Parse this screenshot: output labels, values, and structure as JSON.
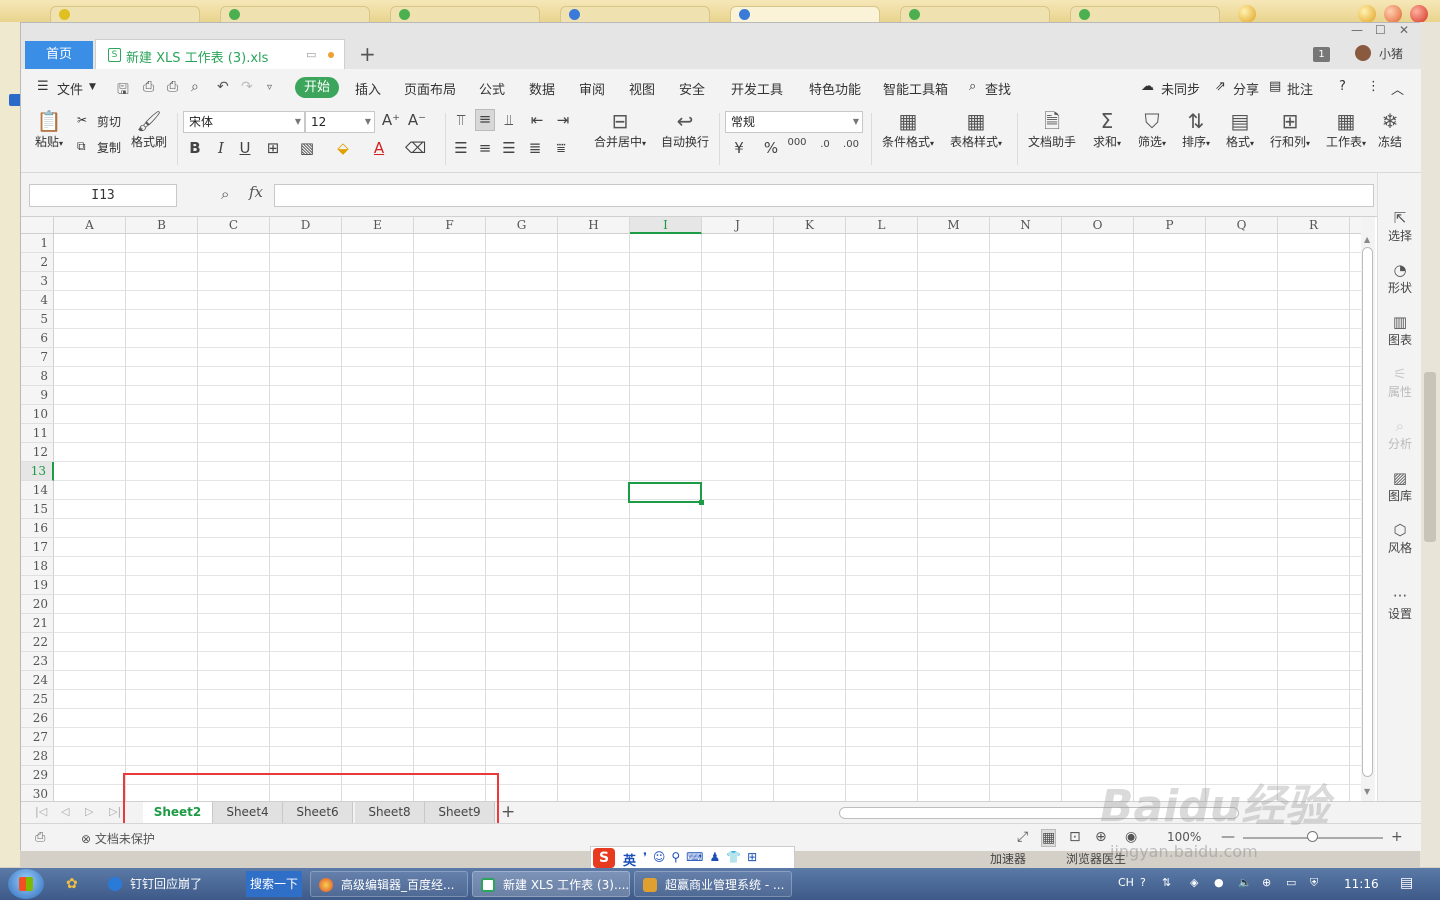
{
  "app": {
    "home_tab": "首页",
    "doc_tab": "新建 XLS 工作表 (3).xls",
    "tab_count": "1",
    "username": "小猪"
  },
  "menu": {
    "file": "文件",
    "items": [
      "开始",
      "插入",
      "页面布局",
      "公式",
      "数据",
      "审阅",
      "视图",
      "安全",
      "开发工具",
      "特色功能",
      "智能工具箱"
    ],
    "search": "查找",
    "right": [
      "未同步",
      "分享",
      "批注"
    ]
  },
  "ribbon": {
    "paste": "粘贴",
    "cut": "剪切",
    "copy": "复制",
    "format_painter": "格式刷",
    "font_name": "宋体",
    "font_size": "12",
    "merge_center": "合并居中",
    "auto_wrap": "自动换行",
    "number_format": "常规",
    "cond_format": "条件格式",
    "table_style": "表格样式",
    "doc_helper": "文档助手",
    "sum": "求和",
    "filter": "筛选",
    "sort": "排序",
    "format": "格式",
    "row_col": "行和列",
    "worksheet": "工作表",
    "freeze": "冻结"
  },
  "formula_bar": {
    "cell_ref": "I13",
    "fx": "fx",
    "value": ""
  },
  "grid": {
    "columns": [
      "A",
      "B",
      "C",
      "D",
      "E",
      "F",
      "G",
      "H",
      "I",
      "J",
      "K",
      "L",
      "M",
      "N",
      "O",
      "P",
      "Q",
      "R"
    ],
    "rows": [
      "1",
      "2",
      "3",
      "4",
      "5",
      "6",
      "7",
      "8",
      "9",
      "10",
      "11",
      "12",
      "13",
      "14",
      "15",
      "16",
      "17",
      "18",
      "19",
      "20",
      "21",
      "22",
      "23",
      "24",
      "25",
      "26",
      "27",
      "28",
      "29",
      "30"
    ],
    "active_col": "I",
    "active_row": "13"
  },
  "side_panel": {
    "items": [
      "选择",
      "形状",
      "图表",
      "属性",
      "分析",
      "图库",
      "风格",
      "设置"
    ]
  },
  "sheet_tabs": {
    "tabs": [
      "Sheet2",
      "Sheet4",
      "Sheet6",
      "Sheet8",
      "Sheet9"
    ],
    "active": "Sheet2"
  },
  "status": {
    "protect": "文档未保护",
    "zoom": "100%"
  },
  "ime": {
    "lang": "英"
  },
  "bg_tray": {
    "accelerator": "加速器",
    "browser_doctor": "浏览器医生"
  },
  "taskbar": {
    "items": [
      "钉钉回应崩了",
      "搜索一下",
      "高级编辑器_百度经...",
      "新建 XLS 工作表 (3)....",
      "超赢商业管理系统 - ..."
    ],
    "tray_lang": "CH",
    "clock": "11:16"
  },
  "watermark": {
    "main": "Baidu经验",
    "sub": "jingyan.baidu.com"
  },
  "colors": {
    "accent_green": "#1e9b45",
    "home_tab_blue": "#3a8ee6",
    "highlight_red": "#e83a3a"
  }
}
